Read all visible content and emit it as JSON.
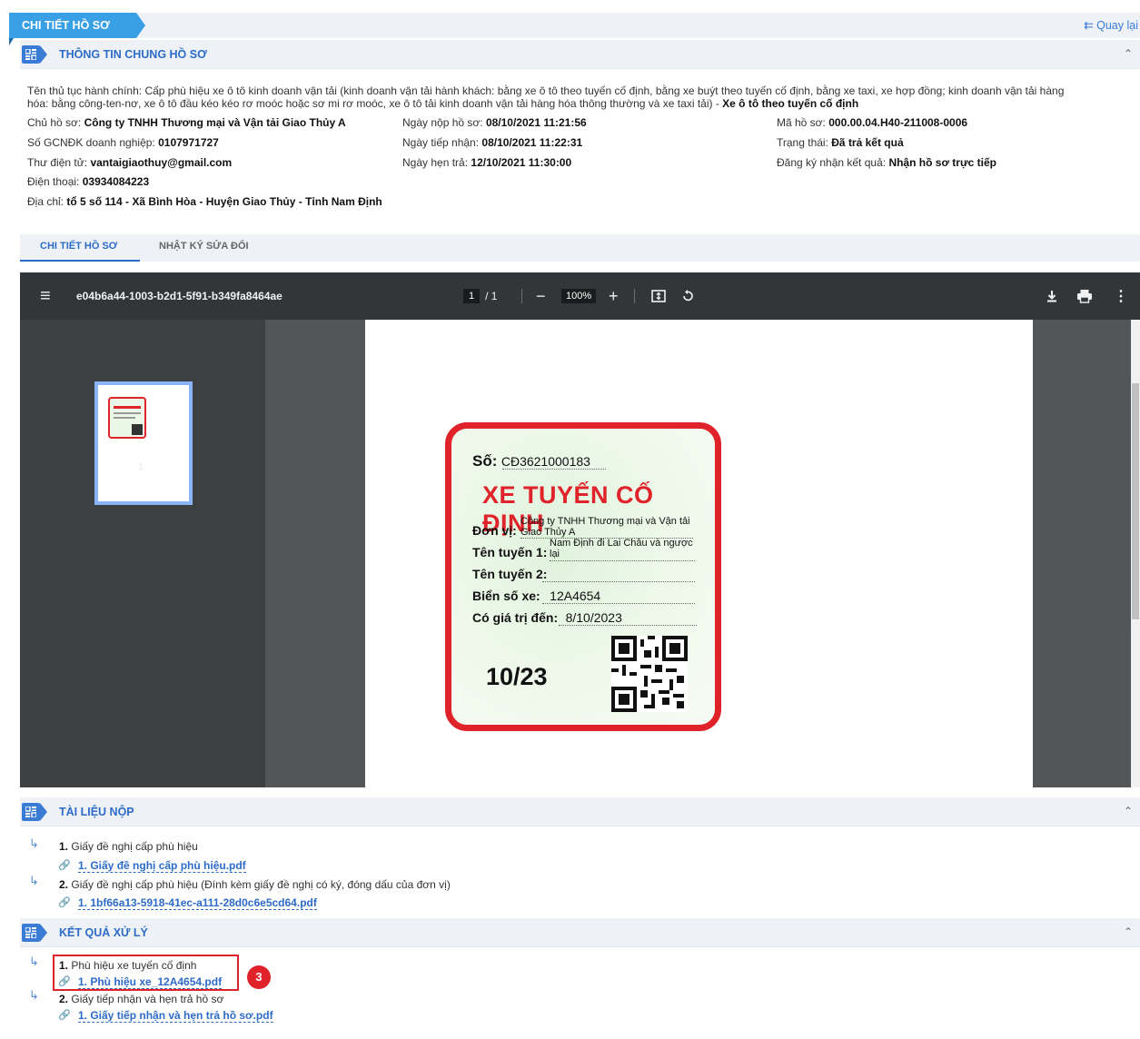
{
  "header": {
    "title": "CHI TIẾT HỒ SƠ",
    "back_label": "⇇ Quay lại"
  },
  "general": {
    "title": "THÔNG TIN CHUNG HỒ SƠ",
    "procedure_label": "Tên thủ tục hành chính:",
    "procedure_text": "Cấp phù hiệu xe ô tô kinh doanh vận tải (kinh doanh vận tải hành khách: bằng xe ô tô theo tuyến cố định, bằng xe buýt theo tuyến cố định, bằng xe taxi, xe hợp đồng; kinh doanh vận tải hàng",
    "procedure_text2": "hóa: bằng công-ten-nơ, xe ô tô đầu kéo kéo rơ moóc hoặc sơ mi rơ moóc, xe ô tô tải kinh doanh vận tải hàng hóa thông thường và xe taxi tải) -",
    "procedure_bold": "Xe ô tô theo tuyến cố định",
    "owner_label": "Chủ hồ sơ:",
    "owner": "Công ty TNHH Thương mại và Vận tải Giao Thủy A",
    "gcn_label": "Số GCNĐK doanh nghiệp:",
    "gcn": "0107971727",
    "email_label": "Thư điện tử:",
    "email": "vantaigiaothuy@gmail.com",
    "phone_label": "Điện thoại:",
    "phone": "03934084223",
    "address_label": "Địa chỉ:",
    "address": "tổ 5 số 114 - Xã Bình Hòa - Huyện Giao Thủy - Tỉnh Nam Định",
    "submit_label": "Ngày nộp hồ sơ:",
    "submit": "08/10/2021 11:21:56",
    "receive_label": "Ngày tiếp nhận:",
    "receive": "08/10/2021 11:22:31",
    "due_label": "Ngày hẹn trả:",
    "due": "12/10/2021 11:30:00",
    "code_label": "Mã hồ sơ:",
    "code": "000.00.04.H40-211008-0006",
    "status_label": "Trạng thái:",
    "status": "Đã trả kết quả",
    "result_label": "Đăng ký nhận kết quả:",
    "result": "Nhận hồ sơ trực tiếp"
  },
  "tabs": [
    {
      "label": "CHI TIẾT HỒ SƠ",
      "active": true
    },
    {
      "label": "NHẬT KÝ SỬA ĐỔI",
      "active": false
    }
  ],
  "viewer": {
    "file_name": "e04b6a44-1003-b2d1-5f91-b349fa8464ae",
    "page_current": "1",
    "page_total": "/ 1",
    "zoom": "100%",
    "thumb_label": "1",
    "badge": {
      "so_label": "Số:",
      "so_value": "CĐ3621000183",
      "title": "XE TUYẾN CỐ ĐỊNH",
      "unit_label": "Đơn vị:",
      "unit_value": "Công ty TNHH Thương mại và Vận tải",
      "unit_value2": "Giao Thủy A",
      "route1_label": "Tên tuyến 1:",
      "route1_value": "Nam Định đi Lai Châu và ngược",
      "route1_value2": "lại",
      "route2_label": "Tên tuyến 2:",
      "plate_label": "Biển số xe:",
      "plate_value": "12A4654",
      "valid_label": "Có giá trị đến:",
      "valid_value": "8/10/2023",
      "big_date": "10/23"
    }
  },
  "documents": {
    "title": "TÀI LIỆU NỘP",
    "items": [
      {
        "num": "1.",
        "name": "Giấy đề nghị cấp phù hiệu",
        "file": "1. Giấy đề nghị cấp phù hiệu.pdf"
      },
      {
        "num": "2.",
        "name": "Giấy đề nghị cấp phù hiệu (Đính kèm giấy đề nghị có ký, đóng dấu của đơn vị)",
        "file": "1. 1bf66a13-5918-41ec-a111-28d0c6e5cd64.pdf"
      }
    ]
  },
  "results": {
    "title": "KẾT QUẢ XỬ LÝ",
    "items": [
      {
        "num": "1.",
        "name": "Phù hiệu xe tuyến cố định",
        "file": "1. Phù hiệu xe_12A4654.pdf"
      },
      {
        "num": "2.",
        "name": "Giấy tiếp nhận và hẹn trả hồ sơ",
        "file": "1. Giấy tiếp nhận và hẹn trả hồ sơ.pdf"
      }
    ],
    "step_marker": "3"
  }
}
